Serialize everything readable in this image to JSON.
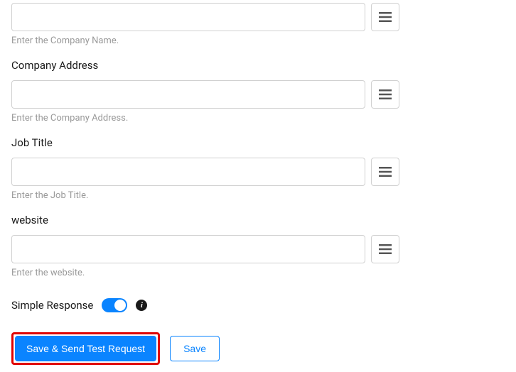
{
  "fields": [
    {
      "label": "",
      "value": "",
      "help": "Enter the Company Name."
    },
    {
      "label": "Company Address",
      "value": "",
      "help": "Enter the Company Address."
    },
    {
      "label": "Job Title",
      "value": "",
      "help": "Enter the Job Title."
    },
    {
      "label": "website",
      "value": "",
      "help": "Enter the website."
    }
  ],
  "simple_response": {
    "label": "Simple Response",
    "enabled": true
  },
  "buttons": {
    "primary": "Save & Send Test Request",
    "secondary": "Save"
  }
}
